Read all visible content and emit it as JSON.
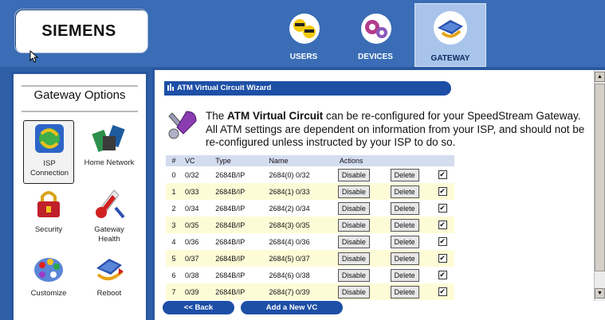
{
  "header": {
    "logo": "SIEMENS",
    "tabs": [
      {
        "label": "USERS",
        "icon": "users-icon"
      },
      {
        "label": "DEVICES",
        "icon": "devices-icon"
      },
      {
        "label": "GATEWAY",
        "icon": "gateway-icon",
        "active": true
      }
    ]
  },
  "sidebar": {
    "title": "Gateway Options",
    "items": [
      {
        "label": "ISP Connection",
        "icon": "isp-connection-icon",
        "selected": true
      },
      {
        "label": "Home Network",
        "icon": "home-network-icon"
      },
      {
        "label": "Security",
        "icon": "security-icon"
      },
      {
        "label": "Gateway Health",
        "icon": "gateway-health-icon"
      },
      {
        "label": "Customize",
        "icon": "customize-icon"
      },
      {
        "label": "Reboot",
        "icon": "reboot-icon"
      }
    ]
  },
  "main": {
    "wizard_title": "ATM Virtual Circuit Wizard",
    "description": {
      "prefix": "The ",
      "bold": "ATM Virtual Circuit",
      "suffix": " can be re-configured for your SpeedStream Gateway. All ATM settings are dependent on information from your ISP, and should not be re-configured unless instructed by your ISP to do so."
    },
    "table": {
      "headers": [
        "#",
        "VC",
        "Type",
        "Name",
        "Actions"
      ],
      "rows": [
        {
          "num": "0",
          "vc": "0/32",
          "type": "2684B/IP",
          "name": "2684(0) 0/32",
          "disable": "Disable",
          "delete": "Delete",
          "checked": "✔"
        },
        {
          "num": "1",
          "vc": "0/33",
          "type": "2684B/IP",
          "name": "2684(1) 0/33",
          "disable": "Disable",
          "delete": "Delete",
          "checked": "✔"
        },
        {
          "num": "2",
          "vc": "0/34",
          "type": "2684B/IP",
          "name": "2684(2) 0/34",
          "disable": "Disable",
          "delete": "Delete",
          "checked": "✔"
        },
        {
          "num": "3",
          "vc": "0/35",
          "type": "2684B/IP",
          "name": "2684(3) 0/35",
          "disable": "Disable",
          "delete": "Delete",
          "checked": "✔"
        },
        {
          "num": "4",
          "vc": "0/36",
          "type": "2684B/IP",
          "name": "2684(4) 0/36",
          "disable": "Disable",
          "delete": "Delete",
          "checked": "✔"
        },
        {
          "num": "5",
          "vc": "0/37",
          "type": "2684B/IP",
          "name": "2684(5) 0/37",
          "disable": "Disable",
          "delete": "Delete",
          "checked": "✔"
        },
        {
          "num": "6",
          "vc": "0/38",
          "type": "2684B/IP",
          "name": "2684(6) 0/38",
          "disable": "Disable",
          "delete": "Delete",
          "checked": "✔"
        },
        {
          "num": "7",
          "vc": "0/39",
          "type": "2684B/IP",
          "name": "2684(7) 0/39",
          "disable": "Disable",
          "delete": "Delete",
          "checked": "✔"
        }
      ]
    },
    "back_label": "<< Back",
    "add_label": "Add a New VC"
  },
  "colors": {
    "header_bg": "#3a6db5",
    "accent_blue": "#1d4fa6",
    "row_alt": "#fefcd7"
  }
}
